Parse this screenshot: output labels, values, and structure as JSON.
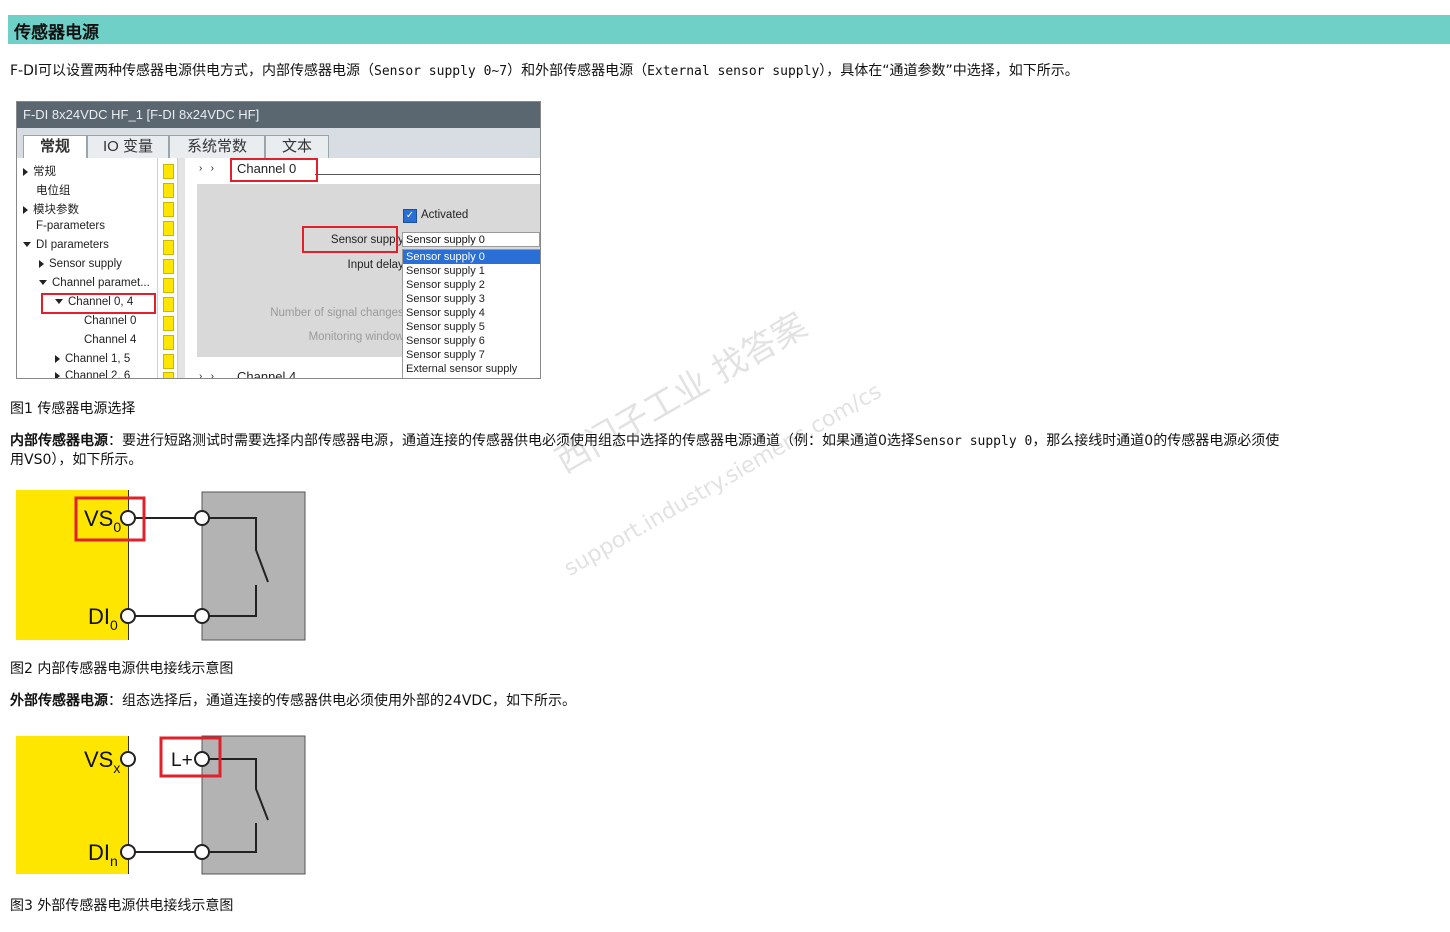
{
  "section": {
    "title": "传感器电源"
  },
  "intro": {
    "text_a": "F-DI可以设置两种传感器电源供电方式，内部传感器电源（",
    "mono_a": "Sensor supply 0~7",
    "text_b": "）和外部传感器电源（",
    "mono_b": "External sensor supply",
    "text_c": "），具体在“通道参数”中选择，如下所示。"
  },
  "tia": {
    "window_title": "F-DI 8x24VDC HF_1 [F-DI 8x24VDC HF]",
    "tabs": [
      "常规",
      "IO 变量",
      "系统常数",
      "文本"
    ],
    "tree": [
      "常规",
      "电位组",
      "模块参数",
      "F-parameters",
      "DI parameters",
      "Sensor supply",
      "Channel paramet...",
      "Channel 0, 4",
      "Channel 0",
      "Channel 4",
      "Channel 1, 5",
      "Channel 2, 6"
    ],
    "breadcrumb": "Channel 0",
    "breadcrumb_bottom": "Channel 4",
    "activated_label": "Activated",
    "sensor_supply_label": "Sensor supply:",
    "input_delay_label": "Input delay:",
    "signal_changes_label": "Number of signal changes:",
    "monitoring_window_label": "Monitoring window:",
    "dropdown_value": "Sensor supply 0",
    "dropdown_options": [
      "Sensor supply 0",
      "Sensor supply 1",
      "Sensor supply 2",
      "Sensor supply 3",
      "Sensor supply 4",
      "Sensor supply 5",
      "Sensor supply 6",
      "Sensor supply 7",
      "External sensor supply"
    ],
    "selected_option_index": 0
  },
  "fig1_caption": "图1 传感器电源选择",
  "internal": {
    "lead": "内部传感器电源",
    "text_a": "：要进行短路测试时需要选择内部传感器电源，通道连接的传感器供电必须使用组态中选择的传感器电源通道（例：如果通道0选择",
    "mono_a": "Sensor supply 0",
    "text_b": "，那么接线时通道0的传感器电源必须使",
    "text_c": "用VS0），如下所示。"
  },
  "diagram1": {
    "vs_label": "VS",
    "vs_sub": "0",
    "di_label": "DI",
    "di_sub": "0"
  },
  "fig2_caption": "图2 内部传感器电源供电接线示意图",
  "external": {
    "lead": "外部传感器电源",
    "text": "：组态选择后，通道连接的传感器供电必须使用外部的24VDC，如下所示。"
  },
  "diagram2": {
    "vs_label": "VS",
    "vs_sub": "x",
    "lplus_label": "L+",
    "di_label": "DI",
    "di_sub": "n"
  },
  "fig3_caption": "图3 外部传感器电源供电接线示意图",
  "watermark": {
    "line1": "西门子工业 找答案",
    "line2": "support.industry.siemens.com/cs"
  }
}
